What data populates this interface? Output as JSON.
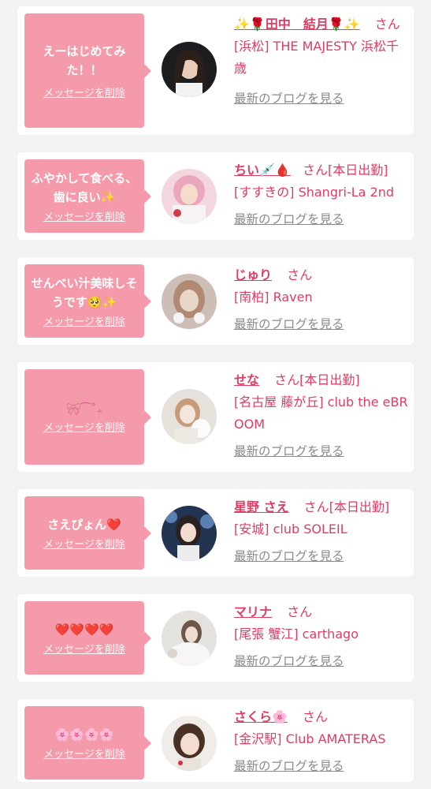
{
  "colors": {
    "accent": "#e03b63",
    "bubble": "#f59aaa",
    "muted": "#8a8a8a",
    "background": "#f2f2f3"
  },
  "delete_label": "メッセージを削除",
  "blog_label": "最新のブログを見る",
  "honorific": "さん",
  "items": [
    {
      "message": "えーはじめてみた！！",
      "name": "✨🌹田中　結月🌹✨",
      "status": "",
      "shop": "[浜松] THE MAJESTY 浜松千歳"
    },
    {
      "message": "ふやかして食べる、歯に良い✨",
      "name": "ちい💉🩸",
      "status": "[本日出勤]",
      "shop": "[すすきの] Shangri-La 2nd"
    },
    {
      "message": "せんべい汁美味しそうです🥺✨",
      "name": "じゅり",
      "status": "",
      "shop": "[南柏] Raven"
    },
    {
      "message": "🎀︎⁀˚₊",
      "name": "せな",
      "status": "[本日出勤]",
      "shop": "[名古屋 藤が丘] club the eBROOM"
    },
    {
      "message": "さえぴょん❤️",
      "name": "星野 さえ",
      "status": "[本日出勤]",
      "shop": "[安城] club SOLEIL"
    },
    {
      "message": "❤️❤️❤️❤️",
      "name": "マリナ",
      "status": "",
      "shop": "[尾張 蟹江] carthago"
    },
    {
      "message": "🌸🌸🌸🌸",
      "name": "さくら🌸",
      "status": "",
      "shop": "[金沢駅] Club AMATERAS"
    }
  ]
}
